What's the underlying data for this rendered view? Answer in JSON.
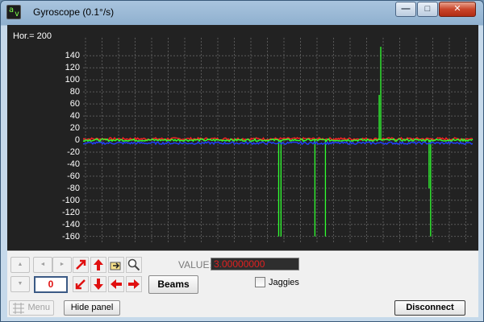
{
  "window": {
    "title": "Gyroscope (0.1°/s)",
    "controls": {
      "minimize": "—",
      "maximize": "□",
      "close": "✕"
    }
  },
  "graph": {
    "horizontal_label": "Hor.= 200",
    "colors": {
      "background": "#222222",
      "grid": "#5a5a5a",
      "red": "#ff2020",
      "green": "#30ff30",
      "blue": "#2040ff"
    }
  },
  "chart_data": {
    "type": "line",
    "title": "",
    "xlabel": "",
    "ylabel": "",
    "ylim": [
      -170,
      170
    ],
    "y_ticks": [
      140,
      120,
      100,
      80,
      60,
      40,
      20,
      0,
      -20,
      -40,
      -60,
      -80,
      -100,
      -120,
      -140,
      -160
    ],
    "series": [
      {
        "color": "#ff2020",
        "baseline": 2,
        "noise": 2
      },
      {
        "color": "#30ff30",
        "baseline": 0,
        "noise": 2,
        "spikes": [
          {
            "x_frac": 0.502,
            "y": -160
          },
          {
            "x_frac": 0.508,
            "y": -160
          },
          {
            "x_frac": 0.595,
            "y": -160
          },
          {
            "x_frac": 0.622,
            "y": -160
          },
          {
            "x_frac": 0.76,
            "y": 75
          },
          {
            "x_frac": 0.764,
            "y": 155
          },
          {
            "x_frac": 0.888,
            "y": -80
          },
          {
            "x_frac": 0.892,
            "y": -160
          }
        ]
      },
      {
        "color": "#2040ff",
        "baseline": -5,
        "noise": 2
      }
    ]
  },
  "panel": {
    "value_label": "VALUE:",
    "value": "3.00000000",
    "counter": "0",
    "beams_label": "Beams",
    "jaggies_label": "Jaggies",
    "jaggies_checked": false,
    "nav": {
      "up": "▲",
      "down": "▼",
      "left": "◄",
      "right": "►"
    }
  },
  "bottom": {
    "menu_label": "Menu",
    "hide_panel_label": "Hide panel",
    "disconnect_label": "Disconnect"
  }
}
